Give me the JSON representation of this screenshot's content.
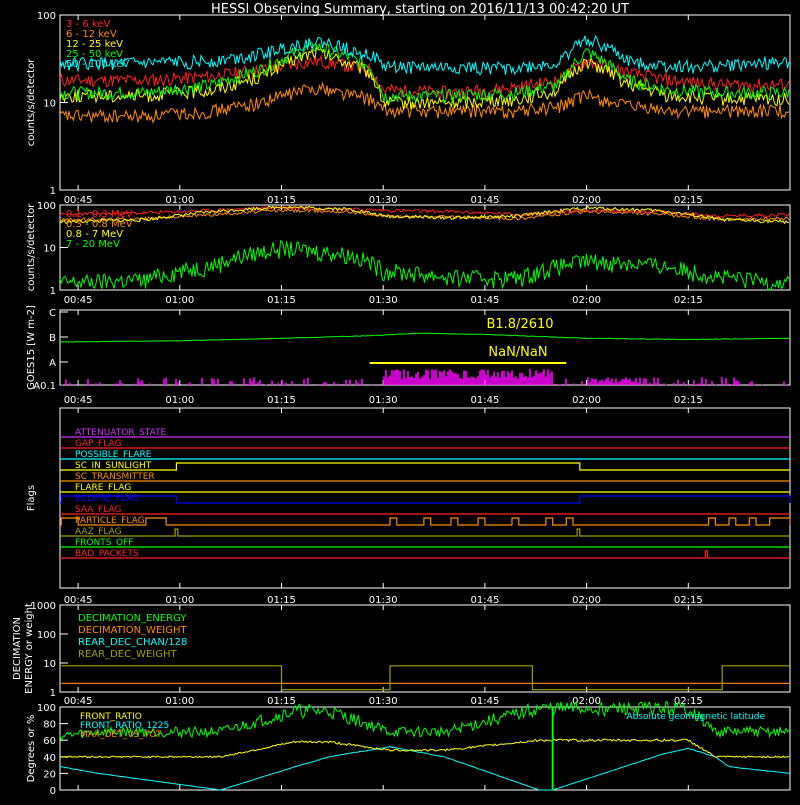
{
  "title": "HESSI Observing Summary, starting on 2016/11/13 00:42:20 UT",
  "time_axis": {
    "ticks": [
      "00:45",
      "01:00",
      "01:15",
      "01:30",
      "01:45",
      "02:00",
      "02:15"
    ],
    "tick_minutes": [
      45,
      60,
      75,
      90,
      105,
      120,
      135
    ],
    "range_minutes": [
      42.33,
      150
    ]
  },
  "colors": {
    "red": "#ff2020",
    "orange": "#ff8c00",
    "yellow": "#ffff00",
    "green": "#00ff00",
    "cyan": "#00ffff",
    "magenta": "#ff00ff",
    "blue": "#0000ff",
    "olive": "#a0a000",
    "violet": "#cc33ff"
  },
  "chart_data": [
    {
      "type": "line",
      "ylabel": "counts/s/detector",
      "yscale": "log",
      "ylim": [
        1,
        100
      ],
      "yticks": [
        "1",
        "10",
        "100"
      ],
      "legend": [
        "3 - 6 keV",
        "6 - 12 keV",
        "12 - 25 keV",
        "25 - 50 keV",
        "50 - 100 keV"
      ],
      "legend_colors": [
        "#ff2020",
        "#ff8c00",
        "#ffff00",
        "#00ff00",
        "#00ffff"
      ],
      "x": [
        42.5,
        55,
        65,
        72,
        80,
        88,
        90,
        100,
        110,
        116,
        120,
        126,
        132,
        140,
        150
      ],
      "series": [
        {
          "color": "#ff2020",
          "values": [
            18,
            18,
            20,
            24,
            30,
            24,
            14,
            13,
            15,
            18,
            30,
            22,
            18,
            16,
            16
          ]
        },
        {
          "color": "#ff8c00",
          "values": [
            7,
            7,
            8,
            10,
            15,
            11,
            8,
            8,
            8,
            9,
            12,
            9,
            8,
            8,
            8
          ]
        },
        {
          "color": "#ffff00",
          "values": [
            12,
            12,
            14,
            20,
            38,
            22,
            10,
            10,
            11,
            14,
            30,
            16,
            12,
            11,
            11
          ]
        },
        {
          "color": "#00ff00",
          "values": [
            13,
            13,
            16,
            24,
            44,
            26,
            12,
            12,
            13,
            16,
            38,
            18,
            14,
            13,
            13
          ]
        },
        {
          "color": "#00ffff",
          "values": [
            28,
            28,
            30,
            36,
            50,
            36,
            26,
            25,
            25,
            28,
            55,
            30,
            26,
            26,
            30
          ]
        }
      ]
    },
    {
      "type": "line",
      "ylabel": "counts/s/detector",
      "yscale": "log",
      "ylim": [
        1,
        100
      ],
      "yticks": [
        "1",
        "10",
        "100"
      ],
      "legend": [
        "0.1 - 0.3 MeV",
        "0.3 - 0.8 MeV",
        "0.8 - 7 MeV",
        "7 - 20 MeV"
      ],
      "legend_colors": [
        "#ff2020",
        "#ff8c00",
        "#ffff00",
        "#00ff00"
      ],
      "x": [
        42.5,
        55,
        65,
        75,
        85,
        90,
        100,
        110,
        120,
        130,
        140,
        150
      ],
      "series": [
        {
          "color": "#ff2020",
          "values": [
            60,
            65,
            75,
            88,
            80,
            75,
            70,
            60,
            75,
            70,
            55,
            60
          ]
        },
        {
          "color": "#ff8c00",
          "values": [
            45,
            48,
            60,
            75,
            70,
            55,
            52,
            48,
            70,
            62,
            45,
            48
          ]
        },
        {
          "color": "#ffff00",
          "values": [
            40,
            45,
            70,
            90,
            80,
            55,
            50,
            55,
            85,
            75,
            45,
            40
          ]
        },
        {
          "color": "#00ff00",
          "values": [
            1.5,
            1.8,
            4,
            10,
            7,
            3,
            2,
            2,
            5,
            4,
            2,
            1.5
          ]
        }
      ]
    },
    {
      "type": "line",
      "ylabel": "GOES15 [W m-2]",
      "yticks": [
        "A0.1",
        "A",
        "B",
        "C"
      ],
      "annotation_flux": "B1.8/2610",
      "annotation_ratio": "NaN/NaN",
      "ratio_bar_range_minutes": [
        88,
        117
      ],
      "x": [
        42.5,
        60,
        75,
        88,
        95,
        105,
        120,
        135,
        150
      ],
      "series": [
        {
          "color": "#00ff00",
          "values": [
            0.8,
            0.85,
            0.95,
            1.05,
            1.15,
            1.1,
            0.95,
            0.9,
            0.95
          ]
        }
      ]
    },
    {
      "type": "table",
      "ylabel": "Flags",
      "flags": [
        {
          "name": "ATTENUATOR_STATE",
          "color": "#cc33ff",
          "intervals": []
        },
        {
          "name": "GAP_FLAG",
          "color": "#ff2020",
          "intervals": []
        },
        {
          "name": "POSSIBLE_FLARE",
          "color": "#00ffff",
          "intervals": []
        },
        {
          "name": "SC_IN_SUNLIGHT",
          "color": "#ffff00",
          "intervals": [
            [
              59.5,
              119
            ]
          ]
        },
        {
          "name": "SC_TRANSMITTER",
          "color": "#ff8c00",
          "intervals": []
        },
        {
          "name": "FLARE_FLAG",
          "color": "#ffff00",
          "intervals": []
        },
        {
          "name": "ECLIPSE_FLAG",
          "color": "#0000ff",
          "intervals": [
            [
              42.5,
              59.5
            ],
            [
              119,
              150
            ]
          ]
        },
        {
          "name": "SAA_FLAG",
          "color": "#ff2020",
          "intervals": []
        },
        {
          "name": "PARTICLE_FLAG",
          "color": "#ff8c00",
          "intervals": [
            [
              42.5,
              45
            ],
            [
              55,
              58
            ],
            [
              91,
              92
            ],
            [
              96,
              97
            ],
            [
              100,
              101
            ],
            [
              104,
              105
            ],
            [
              109,
              110
            ],
            [
              114,
              115
            ],
            [
              117,
              118
            ],
            [
              138,
              139
            ],
            [
              141,
              142
            ],
            [
              144,
              145
            ],
            [
              147,
              150
            ]
          ]
        },
        {
          "name": "AAZ_FLAG",
          "color": "#a0a000",
          "intervals": [
            [
              59.3,
              59.7
            ],
            [
              118.6,
              119
            ]
          ]
        },
        {
          "name": "FRONTS_OFF",
          "color": "#00ff00",
          "intervals": []
        },
        {
          "name": "BAD_PACKETS",
          "color": "#ff2020",
          "intervals": [
            [
              137.5,
              137.8
            ]
          ]
        }
      ]
    },
    {
      "type": "line",
      "ylabel": "DECIMATION ENERGY or weight",
      "yscale": "log",
      "ylim": [
        1,
        1000
      ],
      "yticks": [
        "1",
        "10",
        "100",
        "1000"
      ],
      "legend": [
        "DECIMATION_ENERGY",
        "DECIMATION_WEIGHT",
        "REAR_DEC_CHAN/128",
        "REAR_DEC_WEIGHT"
      ],
      "legend_colors": [
        "#00ff00",
        "#ff8c00",
        "#00ffff",
        "#a0a000"
      ],
      "steps": [
        {
          "color": "#ff8c00",
          "x": [
            42.5,
            150
          ],
          "values": [
            2,
            2
          ]
        },
        {
          "color": "#a0a000",
          "x": [
            42.5,
            75,
            75,
            91,
            91,
            112,
            112,
            140,
            140,
            150
          ],
          "values": [
            8,
            8,
            1.2,
            1.2,
            8,
            8,
            1.2,
            1.2,
            8,
            8
          ]
        }
      ]
    },
    {
      "type": "line",
      "ylabel": "Degrees or %",
      "ylim": [
        0,
        100
      ],
      "yticks": [
        "0",
        "20",
        "40",
        "60",
        "80",
        "100"
      ],
      "legend": [
        "FRONT_RATIO",
        "FRONT_RATIO_1225",
        "MAX_DET_VS_TOT",
        "Absolute geomagnetic latitude"
      ],
      "legend_colors": [
        "#ffff00",
        "#00ffff",
        "#ff8c00",
        "#00ffff"
      ],
      "x": [
        42.5,
        48,
        66,
        77,
        82,
        91,
        99,
        113,
        115,
        130,
        132,
        135,
        139,
        141,
        150
      ],
      "series": [
        {
          "color": "#00ffff",
          "values": [
            28,
            20,
            0,
            28,
            40,
            52,
            40,
            0,
            0,
            40,
            45,
            50,
            40,
            28,
            20
          ]
        },
        {
          "color": "#ffff00",
          "values": [
            40,
            40,
            40,
            58,
            58,
            48,
            48,
            60,
            60,
            60,
            60,
            60,
            40,
            40,
            40
          ]
        },
        {
          "color": "#00ff00",
          "values": [
            65,
            70,
            70,
            95,
            95,
            70,
            70,
            98,
            98,
            98,
            98,
            98,
            70,
            70,
            70
          ]
        }
      ]
    }
  ]
}
